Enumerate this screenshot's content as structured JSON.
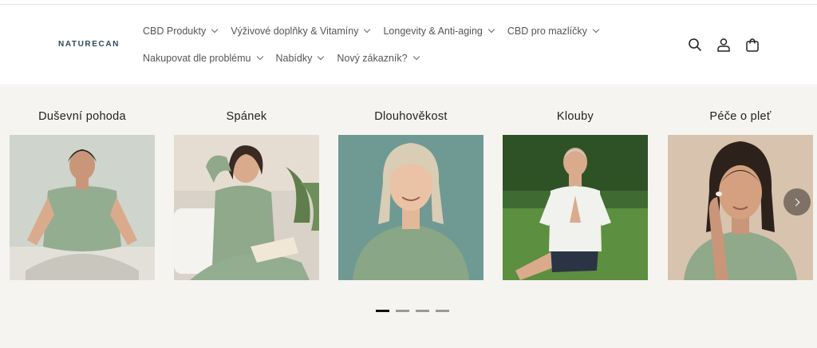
{
  "brand": {
    "logo_text": "NATURECAN"
  },
  "nav": {
    "row1": [
      {
        "label": "CBD Produkty"
      },
      {
        "label": "Výživové doplňky & Vitamíny"
      },
      {
        "label": "Longevity & Anti-aging"
      },
      {
        "label": "CBD pro mazlíčky"
      }
    ],
    "row2": [
      {
        "label": "Nakupovat dle problému"
      },
      {
        "label": "Nabídky"
      },
      {
        "label": "Nový zákazník?"
      }
    ]
  },
  "header_icons": [
    "search-icon",
    "account-icon",
    "cart-icon"
  ],
  "categories": [
    {
      "title": "Duševní pohoda",
      "image": "woman-meditating"
    },
    {
      "title": "Spánek",
      "image": "woman-reading-in-bed"
    },
    {
      "title": "Dlouhověkost",
      "image": "older-woman-smiling"
    },
    {
      "title": "Klouby",
      "image": "older-man-yoga"
    },
    {
      "title": "Péče o pleť",
      "image": "woman-applying-cream"
    }
  ],
  "carousel": {
    "pages": 4,
    "active_page": 1
  },
  "colors": {
    "section_bg": "#f6f4f0",
    "shirt_green": "#8fa98a",
    "logo": "#2f4a5a"
  }
}
